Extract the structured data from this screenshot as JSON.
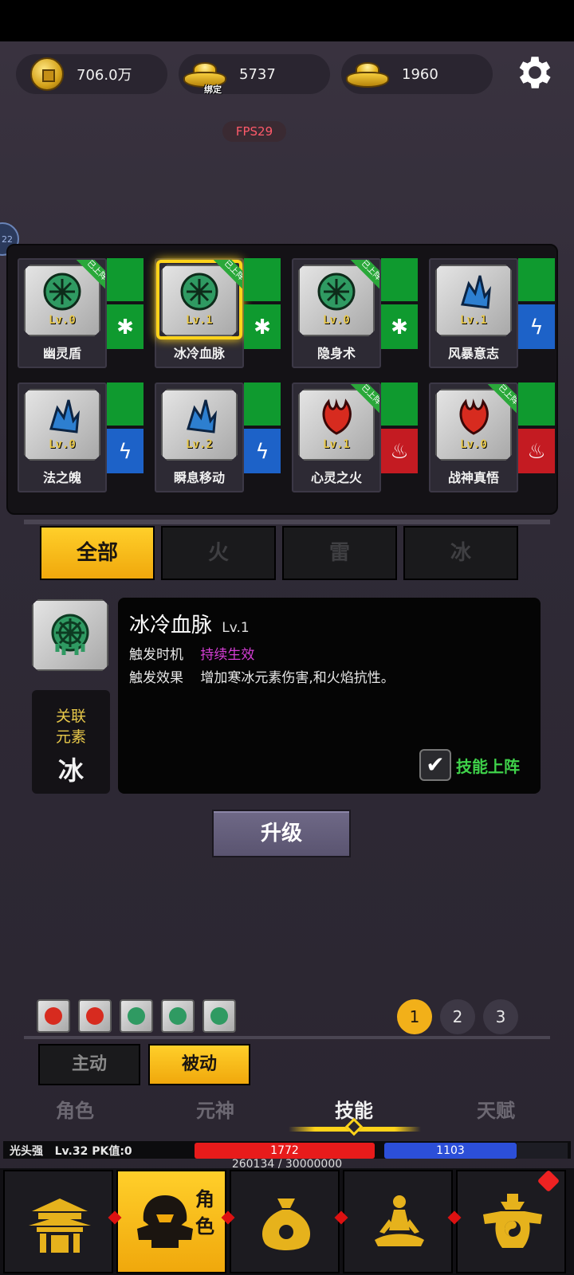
{
  "resources": {
    "coins": "706.0万",
    "bound_gold": "5737",
    "bound_tag": "绑定",
    "gold": "1960"
  },
  "fps": "FPS29",
  "side_badge": "22",
  "skills": [
    {
      "name": "幽灵盾",
      "level": "Lv.0",
      "deployed": true,
      "element": "ice",
      "element_symbol": "✱",
      "emblem_color": "#2f9a62"
    },
    {
      "name": "冰冷血脉",
      "level": "Lv.1",
      "deployed": true,
      "element": "ice",
      "element_symbol": "✱",
      "emblem_color": "#2f9a62",
      "selected": true
    },
    {
      "name": "隐身术",
      "level": "Lv.0",
      "deployed": true,
      "element": "ice",
      "element_symbol": "✱",
      "emblem_color": "#2f9a62"
    },
    {
      "name": "风暴意志",
      "level": "Lv.1",
      "deployed": false,
      "element": "thunder",
      "element_symbol": "ϟ",
      "emblem_color": "#2d7fd0"
    },
    {
      "name": "法之魄",
      "level": "Lv.0",
      "deployed": false,
      "element": "thunder",
      "element_symbol": "ϟ",
      "emblem_color": "#2d7fd0"
    },
    {
      "name": "瞬息移动",
      "level": "Lv.2",
      "deployed": false,
      "element": "thunder",
      "element_symbol": "ϟ",
      "emblem_color": "#2d7fd0"
    },
    {
      "name": "心灵之火",
      "level": "Lv.1",
      "deployed": true,
      "element": "fire",
      "element_symbol": "♨",
      "emblem_color": "#d72b1f"
    },
    {
      "name": "战神真悟",
      "level": "Lv.0",
      "deployed": true,
      "element": "fire",
      "element_symbol": "♨",
      "emblem_color": "#d72b1f"
    }
  ],
  "deployed_ribbon": "已上阵",
  "filter_tabs": [
    "全部",
    "火",
    "雷",
    "冰"
  ],
  "detail": {
    "name": "冰冷血脉",
    "level": "Lv.1",
    "trigger_label": "触发时机",
    "trigger_value": "持续生效",
    "effect_label": "触发效果",
    "effect_value": "增加寒冰元素伤害,和火焰抗性。",
    "assoc_label_1": "关联",
    "assoc_label_2": "元素",
    "assoc_value": "冰",
    "deploy_label": "技能上阵",
    "deploy_checked": true
  },
  "upgrade_label": "升级",
  "slot_colors": [
    "#d72b1f",
    "#d72b1f",
    "#2f9a62",
    "#2f9a62",
    "#2f9a62"
  ],
  "pages": [
    "1",
    "2",
    "3"
  ],
  "mode_tabs": [
    "主动",
    "被动"
  ],
  "section_tabs": [
    "角色",
    "元神",
    "技能",
    "天赋"
  ],
  "player": {
    "name": "光头强",
    "level": "Lv.32",
    "pk_label": "PK值:0",
    "hp": "1772",
    "mp": "1103",
    "exp": "260134 / 30000000"
  },
  "bottom_nav": {
    "active_label_top": "角",
    "active_label_bottom": "色"
  }
}
